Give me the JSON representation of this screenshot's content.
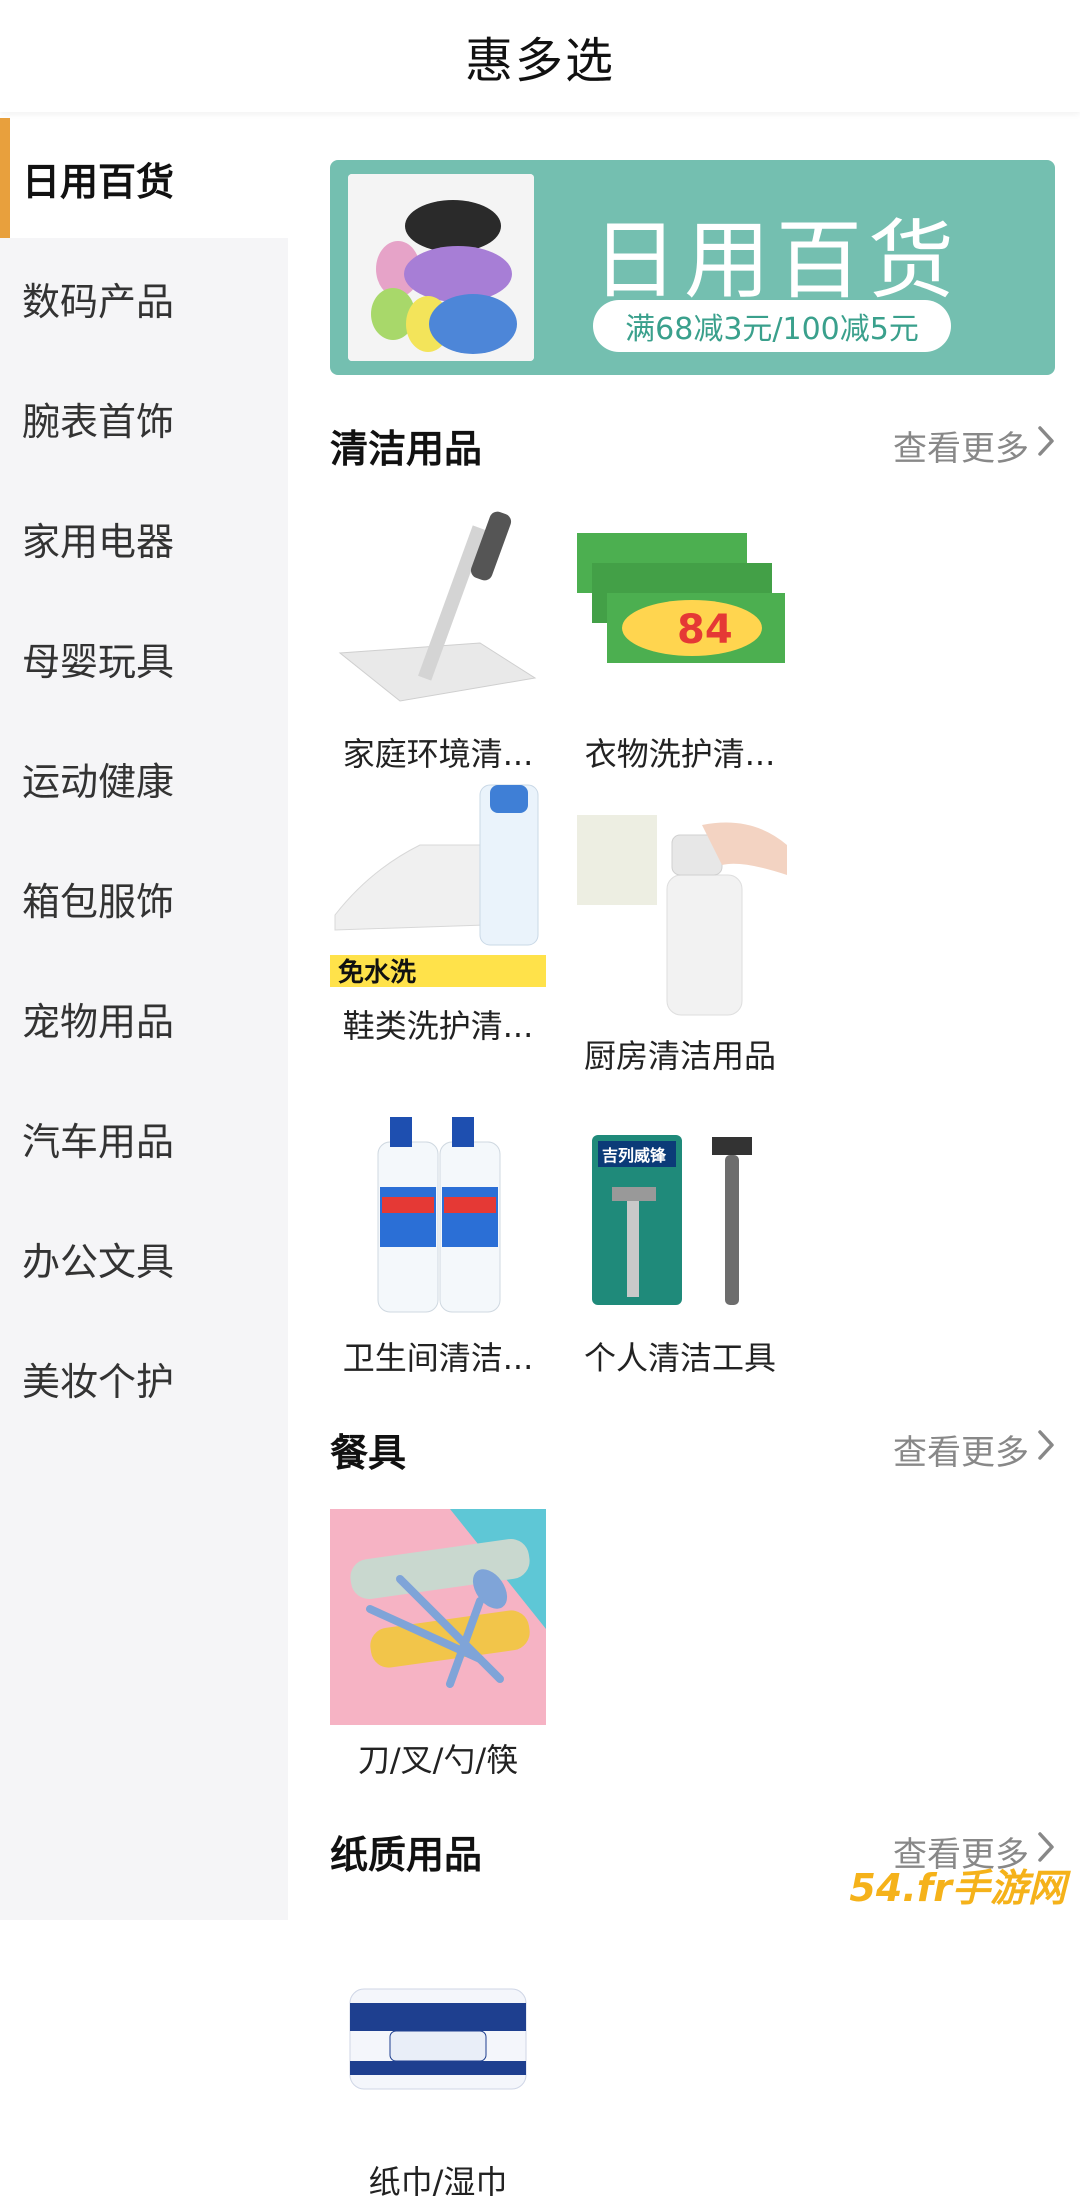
{
  "header": {
    "title": "惠多选"
  },
  "sidebar": {
    "items": [
      {
        "label": "日用百货",
        "active": true
      },
      {
        "label": "数码产品"
      },
      {
        "label": "腕表首饰"
      },
      {
        "label": "家用电器"
      },
      {
        "label": "母婴玩具"
      },
      {
        "label": "运动健康"
      },
      {
        "label": "箱包服饰"
      },
      {
        "label": "宠物用品"
      },
      {
        "label": "汽车用品"
      },
      {
        "label": "办公文具"
      },
      {
        "label": "美妆个护"
      }
    ]
  },
  "banner": {
    "title": "日用百货",
    "subtitle": "满68减3元/100减5元"
  },
  "sections": [
    {
      "title": "清洁用品",
      "more": "查看更多",
      "items": [
        {
          "name": "家庭环境清..."
        },
        {
          "name": "衣物洗护清..."
        },
        {
          "name": "鞋类洗护清..."
        },
        {
          "name": "厨房清洁用品"
        },
        {
          "name": "卫生间清洁..."
        },
        {
          "name": "个人清洁工具"
        }
      ]
    },
    {
      "title": "餐具",
      "more": "查看更多",
      "items": [
        {
          "name": "刀/叉/勺/筷"
        }
      ]
    },
    {
      "title": "纸质用品",
      "more": "查看更多",
      "items": [
        {
          "name": "纸巾/湿巾"
        }
      ]
    }
  ],
  "image_labels": {
    "soap": "84",
    "shoe_cleaner": "免水洗",
    "razor_brand": "吉列威锋"
  },
  "watermark": "54.fr手游网",
  "colors": {
    "accent": "#e8a03d",
    "banner": "#74bfb0",
    "more": "#888888"
  }
}
